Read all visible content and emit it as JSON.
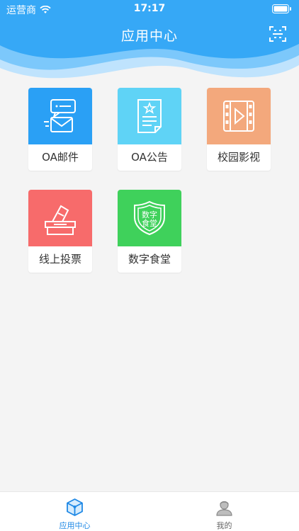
{
  "status_bar": {
    "carrier": "运营商",
    "time": "17:17"
  },
  "header": {
    "title": "应用中心"
  },
  "apps": [
    {
      "label": "OA邮件",
      "color": "#2aa0f5",
      "icon": "mail-message-icon"
    },
    {
      "label": "OA公告",
      "color": "#5fd3f6",
      "icon": "notice-document-icon"
    },
    {
      "label": "校园影视",
      "color": "#f3a87c",
      "icon": "film-play-icon"
    },
    {
      "label": "线上投票",
      "color": "#f76b6b",
      "icon": "ballot-box-icon"
    },
    {
      "label": "数字食堂",
      "color": "#3fd15b",
      "icon": "canteen-shield-icon",
      "badge_text": "数字食堂"
    }
  ],
  "tab_bar": {
    "tabs": [
      {
        "label": "应用中心",
        "icon": "cube-icon",
        "active": true
      },
      {
        "label": "我的",
        "icon": "person-icon",
        "active": false
      }
    ]
  },
  "colors": {
    "accent": "#1e88e5",
    "header": "#36a8f6"
  }
}
